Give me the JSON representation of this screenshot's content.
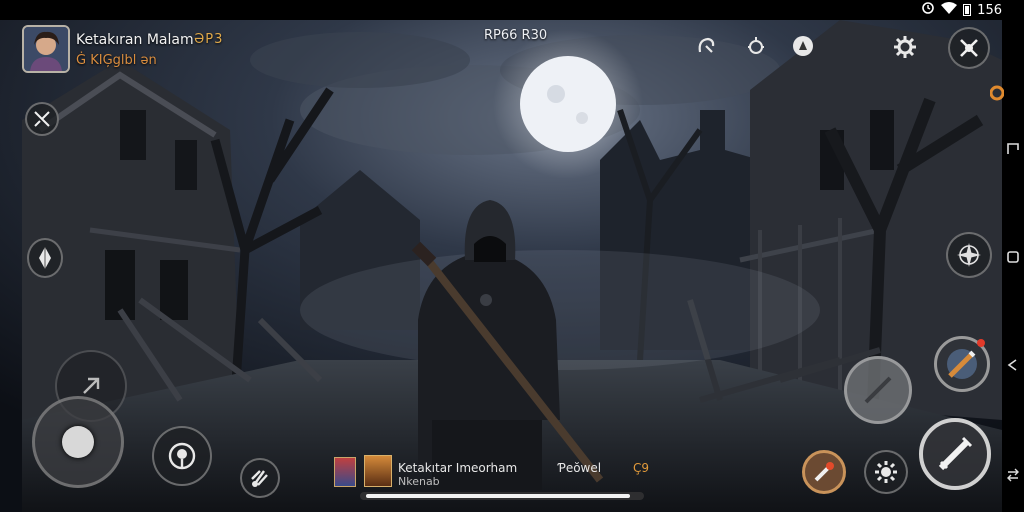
{
  "status_bar": {
    "time": "156",
    "icons": [
      "sync-icon",
      "wifi-icon",
      "battery-icon"
    ]
  },
  "player": {
    "name": "Ketakıran Malam",
    "level": "ƏP3",
    "guild": "Ġ KIĢglbl ən"
  },
  "top_center": {
    "counter": "RP66  R30"
  },
  "top_right_icons": [
    "grapple-hook-icon",
    "gear-alert-icon",
    "compass-badge-icon",
    "settings-gear-icon",
    "crossed-swords-icon"
  ],
  "left_icons": [
    "map-toggle-icon",
    "waypoint-arrow-icon"
  ],
  "right_icons": [
    "crosshair-icon",
    "weapon-skill-icon",
    "jump-button",
    "attack-sword-icon",
    "consumable-icon",
    "gear-skill-icon"
  ],
  "bottom_left_icons": [
    "joystick-icon",
    "stance-icon",
    "claw-skill-icon",
    "movement-arrow-icon"
  ],
  "bottom_bar": {
    "title": "Ketakıtar Imeorham",
    "subtitle": "Nkenab",
    "reward": "Ƥeŏwel",
    "count": "Ç9",
    "progress": 0.97
  },
  "nav_icons": [
    "back-icon",
    "home-icon",
    "recents-icon",
    "rotate-icon"
  ],
  "colors": {
    "accent_orange": "#e08a2e",
    "hud_border": "#aaaaaa",
    "moon": "#eef1f6"
  }
}
